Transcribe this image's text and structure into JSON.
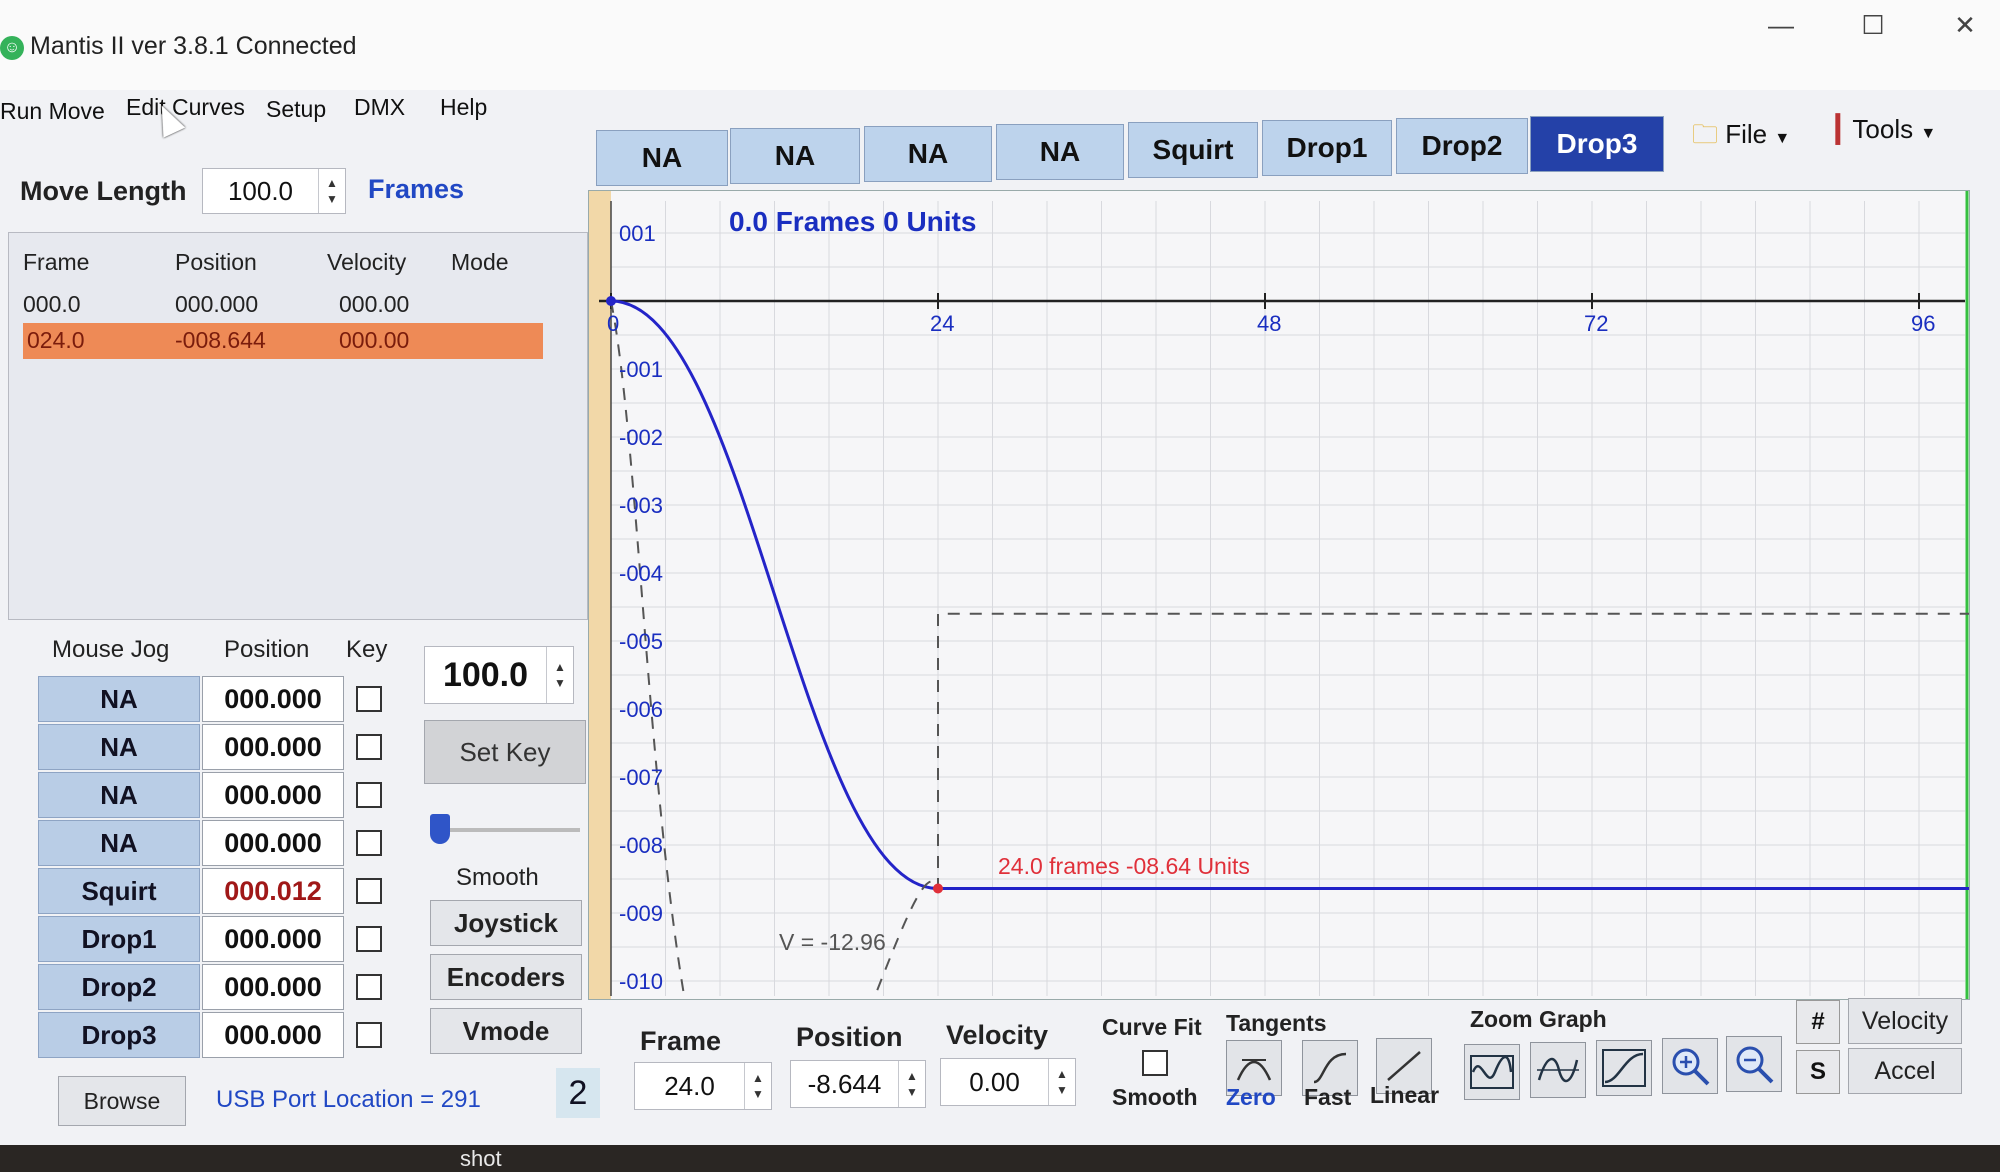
{
  "window": {
    "title": "Mantis II ver 3.8.1 Connected"
  },
  "menu": {
    "items": [
      "Run Move",
      "Edit Curves",
      "Setup",
      "DMX",
      "Help"
    ]
  },
  "move_length": {
    "label": "Move Length",
    "value": "100.0",
    "unit": "Frames"
  },
  "key_table": {
    "headers": [
      "Frame",
      "Position",
      "Velocity",
      "Mode"
    ],
    "rows": [
      {
        "frame": "000.0",
        "position": "000.000",
        "velocity": "000.00",
        "mode": ""
      },
      {
        "frame": "024.0",
        "position": "-008.644",
        "velocity": "000.00",
        "mode": ""
      }
    ]
  },
  "jog": {
    "headers": [
      "Mouse Jog",
      "Position",
      "Key"
    ],
    "rows": [
      {
        "name": "NA",
        "value": "000.000"
      },
      {
        "name": "NA",
        "value": "000.000"
      },
      {
        "name": "NA",
        "value": "000.000"
      },
      {
        "name": "NA",
        "value": "000.000"
      },
      {
        "name": "Squirt",
        "value": "000.012"
      },
      {
        "name": "Drop1",
        "value": "000.000"
      },
      {
        "name": "Drop2",
        "value": "000.000"
      },
      {
        "name": "Drop3",
        "value": "000.000"
      }
    ],
    "speed_value": "100.0",
    "set_key": "Set Key",
    "smooth": "Smooth",
    "joystick": "Joystick",
    "encoders": "Encoders",
    "vmode": "Vmode"
  },
  "footer": {
    "browse": "Browse",
    "usb": "USB Port Location = 291",
    "count": "2"
  },
  "channel_tabs": [
    "NA",
    "NA",
    "NA",
    "NA",
    "Squirt",
    "Drop1",
    "Drop2",
    "Drop3"
  ],
  "tools": {
    "file": "File",
    "tools": "Tools"
  },
  "graph": {
    "readout": "0.0 Frames  0 Units",
    "annotation": "24.0 frames -08.64 Units",
    "velocity_label": "V = -12.96",
    "y_labels": [
      "001",
      "-001",
      "-002",
      "-003",
      "-004",
      "-005",
      "-006",
      "-007",
      "-008",
      "-009",
      "-010"
    ],
    "x_labels": [
      "0",
      "24",
      "48",
      "72",
      "96"
    ]
  },
  "chart_data": {
    "type": "line",
    "x_ticks": [
      0,
      24,
      48,
      72,
      96
    ],
    "ylim": [
      -10,
      1
    ],
    "series": [
      {
        "values_x": [
          0,
          24,
          100
        ],
        "values_y": [
          0,
          -8.64,
          -8.64
        ]
      },
      {
        "values_x": [
          0,
          12,
          24,
          100
        ],
        "values_y": [
          0,
          -12.96,
          -4.6,
          -4.6
        ]
      }
    ]
  },
  "edit": {
    "frame_label": "Frame",
    "frame_value": "24.0",
    "position_label": "Position",
    "position_value": "-8.644",
    "velocity_label": "Velocity",
    "velocity_value": "0.00",
    "curve_fit_label": "Curve Fit",
    "curve_fit_smooth": "Smooth",
    "tangents_label": "Tangents",
    "tangent_zero": "Zero",
    "tangent_fast": "Fast",
    "tangent_linear": "Linear",
    "zoom_label": "Zoom Graph",
    "hash": "#",
    "s": "S",
    "velocity_btn": "Velocity",
    "accel_btn": "Accel"
  },
  "desktop": {
    "shot": "shot"
  },
  "colors": {
    "accent": "#2441a8",
    "selected_row": "#ee8a56",
    "curve": "#2424c8",
    "annotation": "#e0303a"
  }
}
